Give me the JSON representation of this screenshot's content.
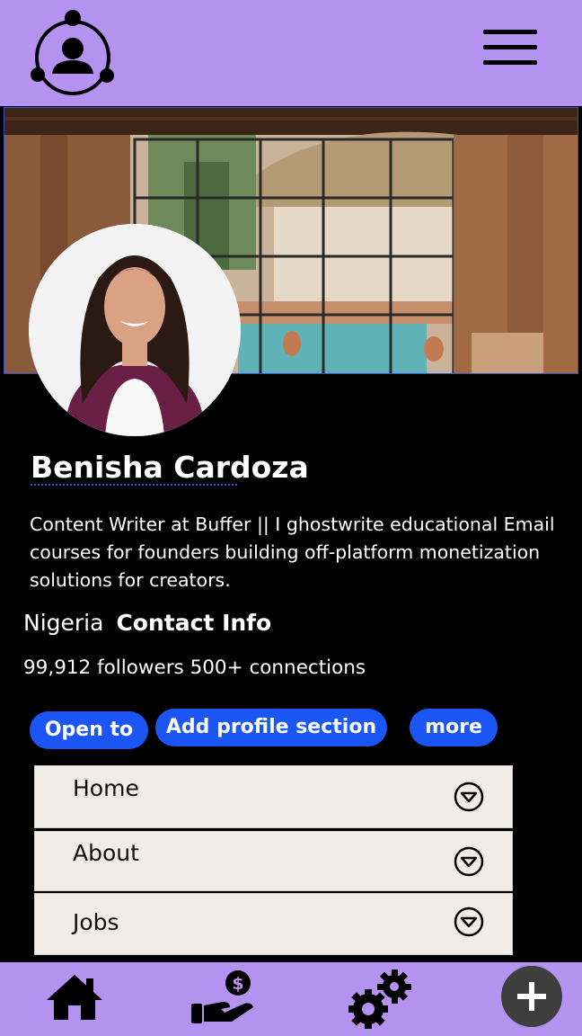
{
  "header": {
    "logo_icon": "profile-network-icon",
    "menu_icon": "hamburger-menu-icon",
    "background_color": "#b392f0"
  },
  "profile": {
    "name": "Benisha Cardoza",
    "bio": "Content Writer at Buffer || I ghostwrite educational Email courses for founders building off-platform monetization solutions for creators.",
    "location": "Nigeria",
    "contact_label": "Contact Info",
    "stats": "99,912 followers 500+ connections"
  },
  "actions": {
    "open_to": "Open to",
    "add_section": "Add profile section",
    "more": "more",
    "accent_color": "#1b56f5"
  },
  "sections": [
    {
      "label": "Home"
    },
    {
      "label": "About"
    },
    {
      "label": "Jobs"
    }
  ],
  "bottom_nav": {
    "items": [
      "home-icon",
      "salary-hand-icon",
      "settings-gears-icon"
    ],
    "fab_icon": "plus-icon"
  }
}
